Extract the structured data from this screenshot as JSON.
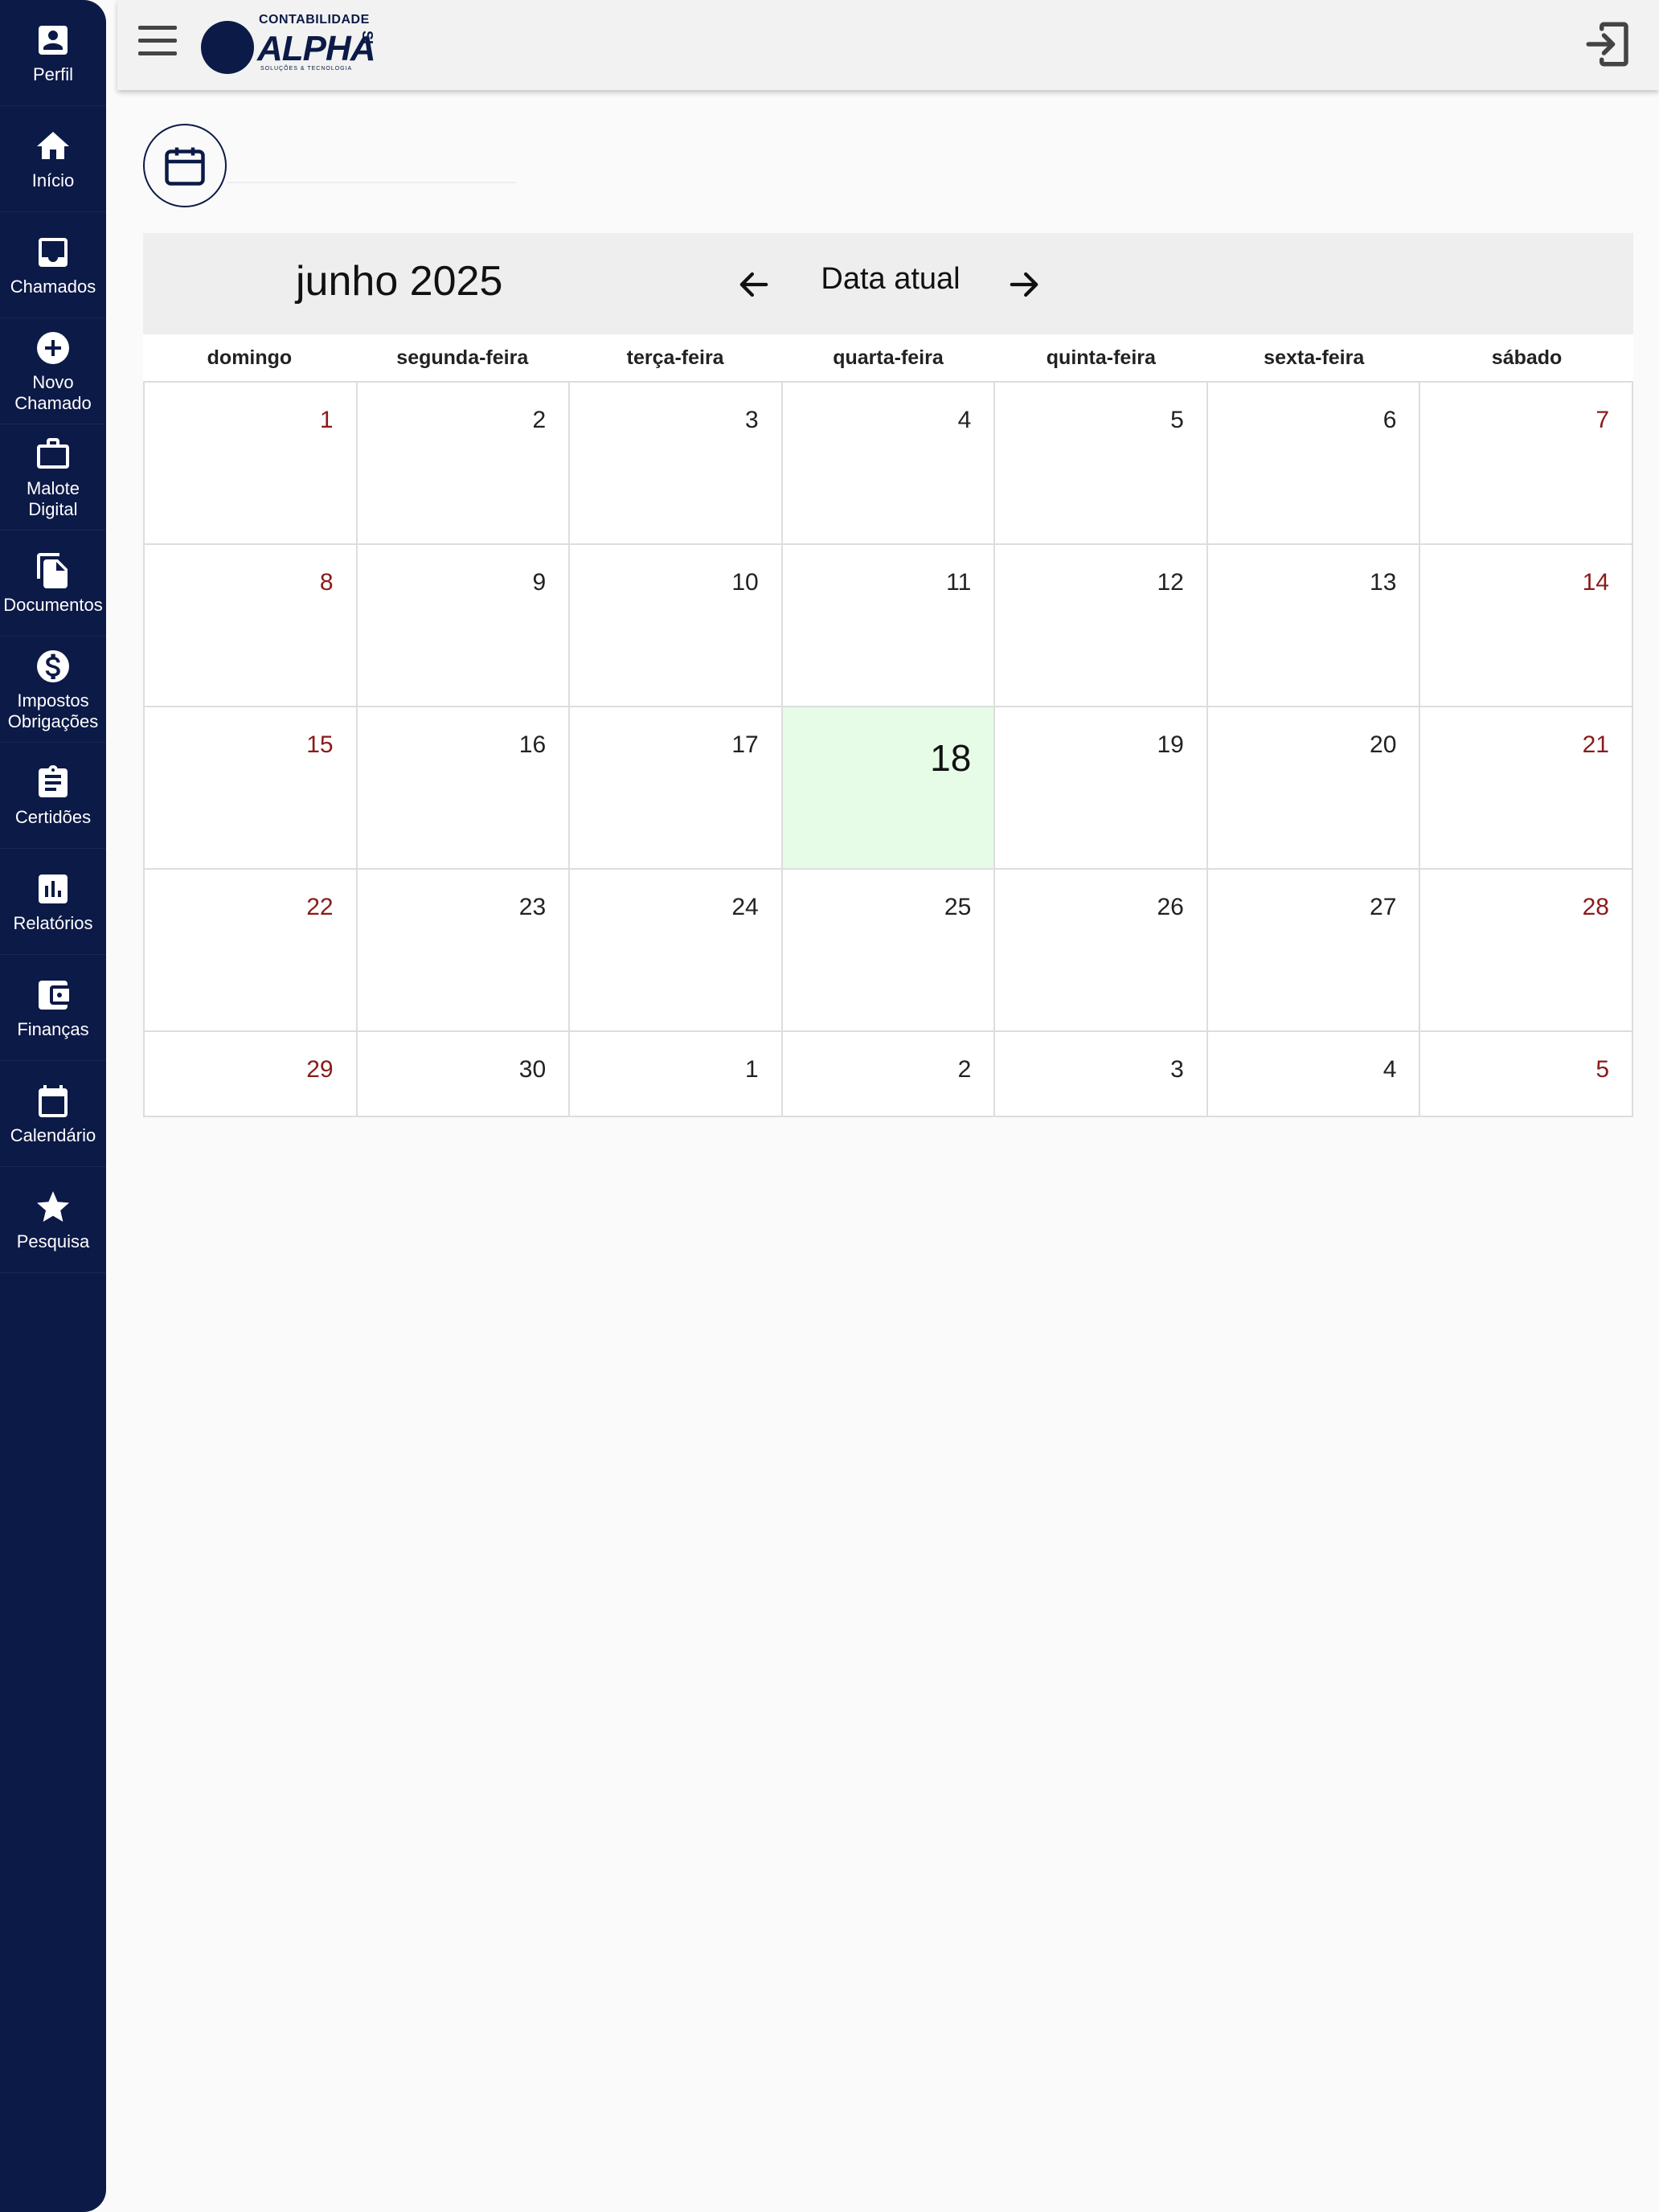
{
  "sidebar": {
    "items": [
      {
        "label": "Perfil",
        "icon": "person-badge-icon"
      },
      {
        "label": "Início",
        "icon": "home-icon"
      },
      {
        "label": "Chamados",
        "icon": "inbox-icon"
      },
      {
        "label": "Novo\nChamado",
        "icon": "add-circle-icon"
      },
      {
        "label": "Malote\nDigital",
        "icon": "briefcase-icon"
      },
      {
        "label": "Documentos",
        "icon": "documents-icon"
      },
      {
        "label": "Impostos\nObrigações",
        "icon": "dollar-circle-icon"
      },
      {
        "label": "Certidões",
        "icon": "clipboard-icon"
      },
      {
        "label": "Relatórios",
        "icon": "bar-chart-icon"
      },
      {
        "label": "Finanças",
        "icon": "wallet-icon"
      },
      {
        "label": "Calendário",
        "icon": "calendar-icon"
      },
      {
        "label": "Pesquisa",
        "icon": "star-icon"
      }
    ]
  },
  "header": {
    "logo_small": "CONTABILIDADE",
    "logo_big": "ALPHA",
    "logo_tagline": "SOLUÇÕES & TECNOLOGIA",
    "logo_side": "SI"
  },
  "calendar": {
    "month_title": "junho 2025",
    "today_label": "Data atual",
    "weekdays": [
      "domingo",
      "segunda-feira",
      "terça-feira",
      "quarta-feira",
      "quinta-feira",
      "sexta-feira",
      "sábado"
    ],
    "days": [
      "1",
      "2",
      "3",
      "4",
      "5",
      "6",
      "7",
      "8",
      "9",
      "10",
      "11",
      "12",
      "13",
      "14",
      "15",
      "16",
      "17",
      "18",
      "19",
      "20",
      "21",
      "22",
      "23",
      "24",
      "25",
      "26",
      "27",
      "28",
      "29",
      "30",
      "1",
      "2",
      "3",
      "4",
      "5"
    ],
    "today": "18"
  },
  "colors": {
    "sidebar_bg": "#0c1a47",
    "weekend_text": "#8b1a1a",
    "today_bg": "#e6fce6",
    "toolbar_bg": "#eeeeee"
  }
}
